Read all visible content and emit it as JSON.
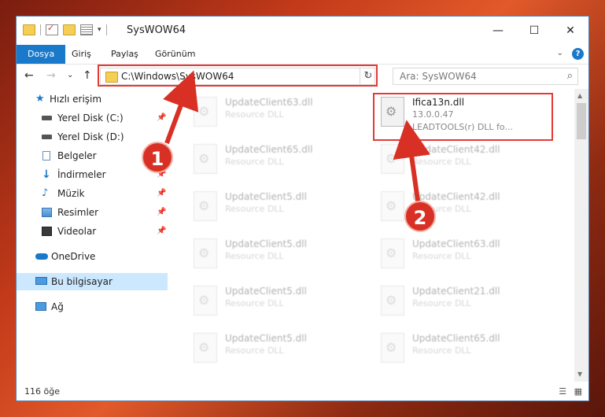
{
  "window": {
    "title": "SysWOW64",
    "controls": {
      "minimize": "—",
      "maximize": "☐",
      "close": "✕"
    }
  },
  "ribbon": {
    "tabs": [
      {
        "label": "Dosya"
      },
      {
        "label": "Giriş"
      },
      {
        "label": "Paylaş"
      },
      {
        "label": "Görünüm"
      }
    ],
    "help": "?",
    "collapse": "⌄"
  },
  "navbar": {
    "back": "←",
    "forward": "→",
    "history": "⌄",
    "up": "↑",
    "address": "C:\\Windows\\SysWOW64",
    "refresh": "↻",
    "search_placeholder": "Ara: SysWOW64",
    "search_icon": "⌕"
  },
  "sidebar": {
    "items": [
      {
        "label": "Hızlı erişim",
        "icon": "star-icon",
        "pinned": false
      },
      {
        "label": "Yerel Disk (C:)",
        "icon": "drive-icon",
        "pinned": true
      },
      {
        "label": "Yerel Disk (D:)",
        "icon": "drive-icon",
        "pinned": false
      },
      {
        "label": "Belgeler",
        "icon": "documents-icon",
        "pinned": true
      },
      {
        "label": "İndirmeler",
        "icon": "download-icon",
        "pinned": true
      },
      {
        "label": "Müzik",
        "icon": "music-icon",
        "pinned": true
      },
      {
        "label": "Resimler",
        "icon": "pictures-icon",
        "pinned": true
      },
      {
        "label": "Videolar",
        "icon": "videos-icon",
        "pinned": true
      },
      {
        "label": "OneDrive",
        "icon": "cloud-icon",
        "pinned": false
      },
      {
        "label": "Bu bilgisayar",
        "icon": "computer-icon",
        "pinned": false,
        "selected": true
      },
      {
        "label": "Ağ",
        "icon": "network-icon",
        "pinned": false
      }
    ],
    "pin_glyph": "📌"
  },
  "files": {
    "highlighted": {
      "name": "Ifica13n.dll",
      "version": "13.0.0.47",
      "description": "LEADTOOLS(r) DLL fo..."
    },
    "left_column": [
      {
        "name": "UpdateClient63.dll",
        "type": "Resource DLL"
      },
      {
        "name": "UpdateClient65.dll",
        "type": "Resource DLL"
      },
      {
        "name": "UpdateClient5.dll",
        "type": "Resource DLL"
      },
      {
        "name": "UpdateClient5.dll",
        "type": "Resource DLL"
      },
      {
        "name": "UpdateClient5.dll",
        "type": "Resource DLL"
      },
      {
        "name": "UpdateClient5.dll",
        "type": "Resource DLL"
      }
    ],
    "right_column": [
      {
        "name": "UpdateClient42.dll",
        "type": "Resource DLL"
      },
      {
        "name": "UpdateClient42.dll",
        "type": "Resource DLL"
      },
      {
        "name": "UpdateClient63.dll",
        "type": "Resource DLL"
      },
      {
        "name": "UpdateClient21.dll",
        "type": "Resource DLL"
      },
      {
        "name": "UpdateClient65.dll",
        "type": "Resource DLL"
      }
    ]
  },
  "status": {
    "count": "116 öğe",
    "view_details": "☰",
    "view_icons": "▦"
  },
  "callouts": [
    {
      "number": "1"
    },
    {
      "number": "2"
    }
  ],
  "colors": {
    "accent": "#1979ca",
    "highlight": "#e53935",
    "selected": "#cce8ff"
  }
}
